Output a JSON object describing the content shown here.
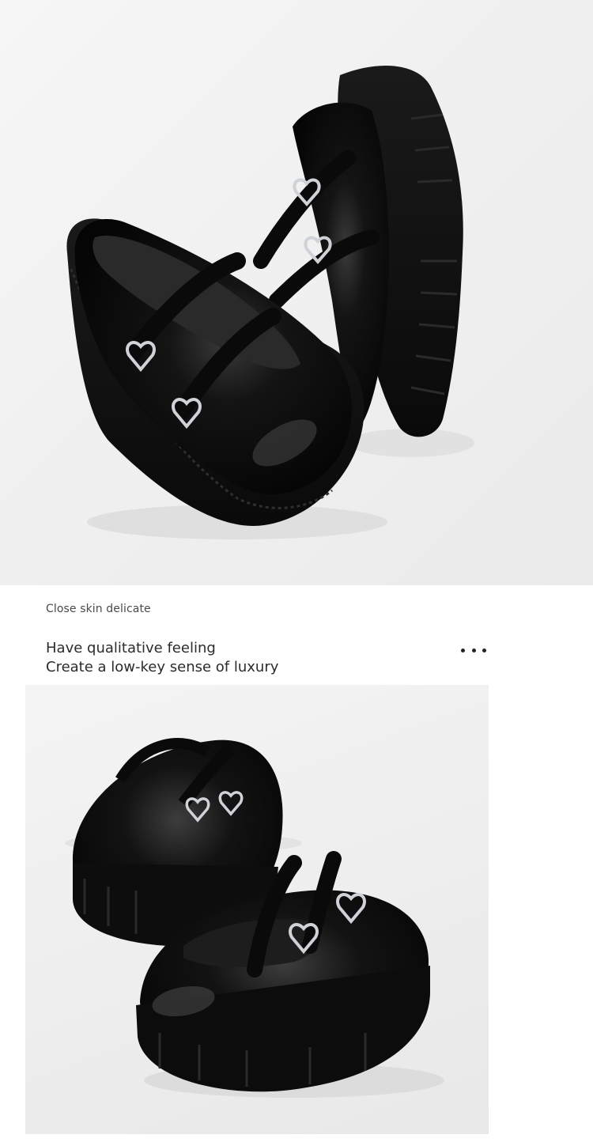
{
  "hero_photo": {
    "description_icon": "shoe-photo",
    "background": "#efefef"
  },
  "caption": "Close skin delicate",
  "headline": {
    "line1": "Have qualitative feeling",
    "line2": "Create a low-key sense of luxury"
  },
  "more_icon": "more-dots-icon",
  "detail_photo": {
    "description_icon": "shoe-photo",
    "background": "#ededed"
  },
  "colors": {
    "leather": "#0c0c0c",
    "buckle": "#cfd2d6",
    "text": "#2b2b2b"
  }
}
